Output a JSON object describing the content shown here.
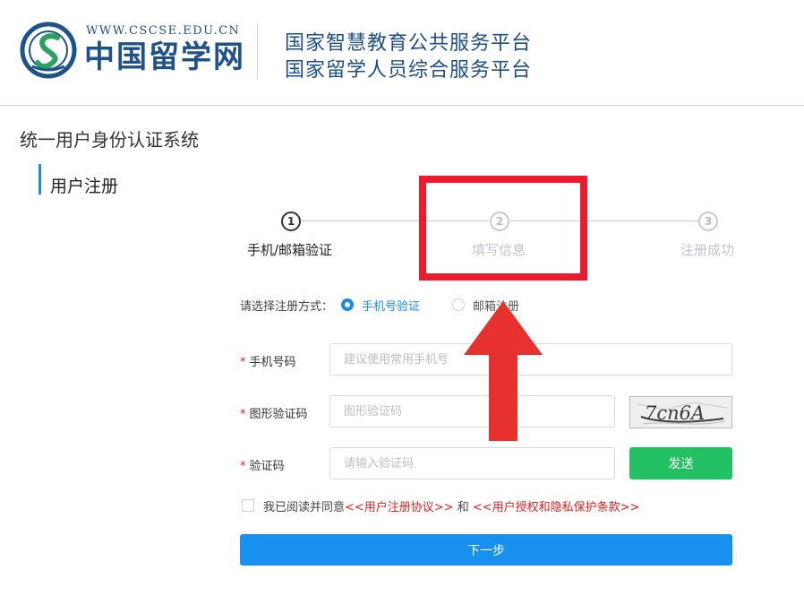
{
  "header": {
    "logo_url": "WWW.CSCSE.EDU.CN",
    "logo_cn": "中国留学网",
    "platform_line1": "国家智慧教育公共服务平台",
    "platform_line2": "国家留学人员综合服务平台"
  },
  "system_title": "统一用户身份认证系统",
  "section_title": "用户注册",
  "steps": [
    {
      "number": "1",
      "label": "手机/邮箱验证",
      "active": true
    },
    {
      "number": "2",
      "label": "填写信息",
      "active": false
    },
    {
      "number": "3",
      "label": "注册成功",
      "active": false
    }
  ],
  "registration_method": {
    "label": "请选择注册方式：",
    "options": [
      {
        "label": "手机号验证",
        "selected": true
      },
      {
        "label": "邮箱注册",
        "selected": false
      }
    ]
  },
  "form": {
    "phone": {
      "label": "手机号码",
      "placeholder": "建议使用常用手机号",
      "value": ""
    },
    "image_code": {
      "label": "图形验证码",
      "placeholder": "图形验证码",
      "value": ""
    },
    "captcha_text": "7cn6A",
    "sms_code": {
      "label": "验证码",
      "placeholder": "请输入验证码",
      "value": ""
    },
    "send_button": "发送",
    "agreement": {
      "prefix": "我已阅读并同意",
      "link1": "<<用户注册协议>>",
      "and": " 和 ",
      "link2": "<<用户授权和隐私保护条款>>",
      "checked": false
    },
    "next_button": "下一步"
  },
  "colors": {
    "primary": "#1890f0",
    "send": "#22c264",
    "highlight": "#ee1b2e",
    "brand": "#1e4f86"
  }
}
